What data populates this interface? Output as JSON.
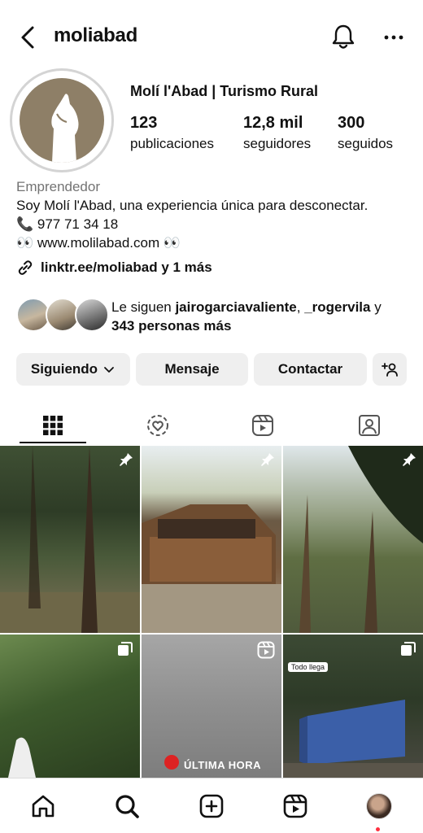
{
  "header": {
    "username": "moliabad",
    "back_icon": "chevron-left-icon",
    "notifications_icon": "bell-icon",
    "more_icon": "more-horizontal-icon"
  },
  "profile": {
    "display_name": "Molí l'Abad | Turismo Rural",
    "stats": [
      {
        "value": "123",
        "label": "publicaciones"
      },
      {
        "value": "12,8 mil",
        "label": "seguidores"
      },
      {
        "value": "300",
        "label": "seguidos"
      }
    ],
    "category": "Emprendedor",
    "bio_lines": [
      "Soy Molí l'Abad, una experiencia única para desconectar.",
      "📞 977 71 34 18",
      "👀 www.molilabad.com 👀"
    ],
    "link": "linktr.ee/moliabad y 1 más"
  },
  "followed_by": {
    "prefix": "Le siguen ",
    "user1": "jairogarciavaliente",
    "separator": ", ",
    "user2": "_rogervila",
    "middle": " y",
    "others": "343 personas más"
  },
  "actions": {
    "following": "Siguiendo",
    "message": "Mensaje",
    "contact": "Contactar"
  },
  "tabs": [
    "grid-icon",
    "reposts-icon",
    "reels-icon",
    "tagged-icon"
  ],
  "grid": {
    "tag_label": "Todo llega",
    "news_label": "ÚLTIMA HORA"
  },
  "bottom_nav": [
    "home-icon",
    "search-icon",
    "create-icon",
    "reels-icon",
    "profile-avatar"
  ]
}
